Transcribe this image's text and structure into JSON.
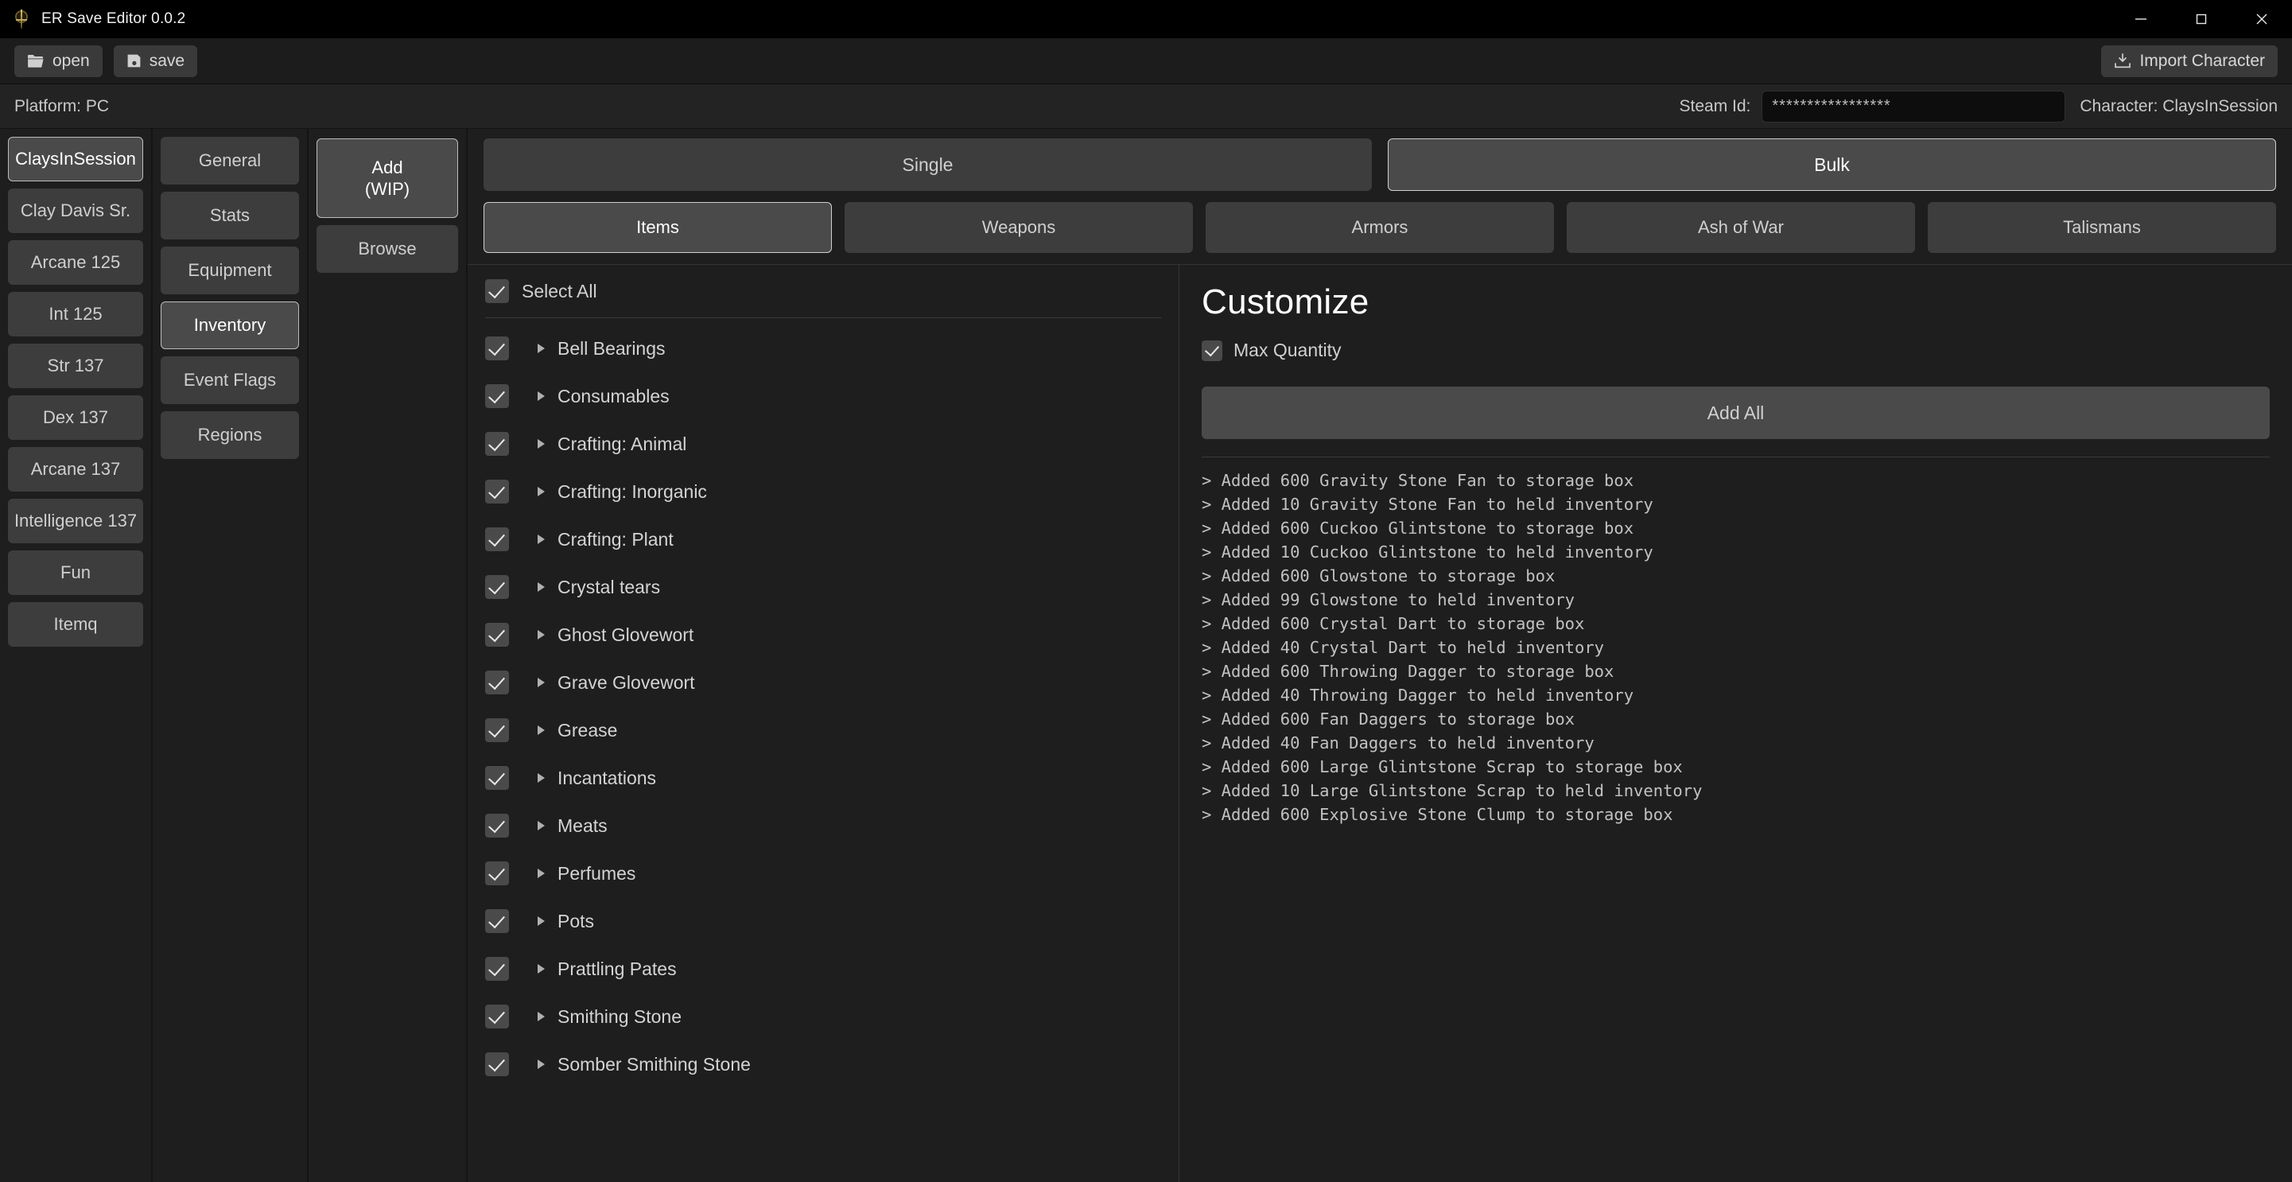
{
  "window": {
    "title": "ER Save Editor 0.0.2",
    "app_icon": "elden-ring-emblem-icon",
    "minimize_icon": "minimize-icon",
    "maximize_icon": "maximize-icon",
    "close_icon": "close-icon"
  },
  "toolbar": {
    "open_label": "open",
    "open_icon": "folder-open-icon",
    "save_label": "save",
    "save_icon": "floppy-disk-icon",
    "import_label": "Import Character",
    "import_icon": "download-icon"
  },
  "infobar": {
    "platform": "Platform: PC",
    "steam_id_label": "Steam Id:",
    "steam_id_value": "*****************",
    "character_label": "Character: ClaysInSession"
  },
  "characters": {
    "selected": "ClaysInSession",
    "items": [
      {
        "label": "ClaysInSession"
      },
      {
        "label": "Clay Davis Sr."
      },
      {
        "label": "Arcane 125"
      },
      {
        "label": "Int 125"
      },
      {
        "label": "Str 137"
      },
      {
        "label": "Dex 137"
      },
      {
        "label": "Arcane 137"
      },
      {
        "label": "Intelligence 137"
      },
      {
        "label": "Fun"
      },
      {
        "label": "Itemq"
      }
    ]
  },
  "sections": {
    "selected": "Inventory",
    "items": [
      {
        "label": "General"
      },
      {
        "label": "Stats"
      },
      {
        "label": "Equipment"
      },
      {
        "label": "Inventory"
      },
      {
        "label": "Event Flags"
      },
      {
        "label": "Regions"
      }
    ]
  },
  "mode_column": {
    "selected": "Add\n(WIP)",
    "items": [
      {
        "line1": "Add",
        "line2": "(WIP)"
      },
      {
        "line1": "Browse",
        "line2": ""
      }
    ]
  },
  "mode_tabs": {
    "selected": "Bulk",
    "items": [
      {
        "label": "Single"
      },
      {
        "label": "Bulk"
      }
    ]
  },
  "category_tabs": {
    "selected": "Items",
    "items": [
      {
        "label": "Items"
      },
      {
        "label": "Weapons"
      },
      {
        "label": "Armors"
      },
      {
        "label": "Ash of War"
      },
      {
        "label": "Talismans"
      }
    ]
  },
  "item_list": {
    "select_all_label": "Select All",
    "select_all_checked": true,
    "rows": [
      {
        "label": "Bell Bearings",
        "checked": true
      },
      {
        "label": "Consumables",
        "checked": true
      },
      {
        "label": "Crafting: Animal",
        "checked": true
      },
      {
        "label": "Crafting: Inorganic",
        "checked": true
      },
      {
        "label": "Crafting: Plant",
        "checked": true
      },
      {
        "label": "Crystal tears",
        "checked": true
      },
      {
        "label": "Ghost Glovewort",
        "checked": true
      },
      {
        "label": "Grave Glovewort",
        "checked": true
      },
      {
        "label": "Grease",
        "checked": true
      },
      {
        "label": "Incantations",
        "checked": true
      },
      {
        "label": "Meats",
        "checked": true
      },
      {
        "label": "Perfumes",
        "checked": true
      },
      {
        "label": "Pots",
        "checked": true
      },
      {
        "label": "Prattling Pates",
        "checked": true
      },
      {
        "label": "Smithing Stone",
        "checked": true
      },
      {
        "label": "Somber Smithing Stone",
        "checked": true
      }
    ]
  },
  "customize": {
    "title": "Customize",
    "max_quantity_label": "Max Quantity",
    "max_quantity_checked": true,
    "add_all_label": "Add All",
    "log_lines": [
      "> Added 600 Gravity Stone Fan to storage box",
      "> Added 10 Gravity Stone Fan to held inventory",
      "> Added 600 Cuckoo Glintstone to storage box",
      "> Added 10 Cuckoo Glintstone to held inventory",
      "> Added 600 Glowstone to storage box",
      "> Added 99 Glowstone to held inventory",
      "> Added 600 Crystal Dart to storage box",
      "> Added 40 Crystal Dart to held inventory",
      "> Added 600 Throwing Dagger to storage box",
      "> Added 40 Throwing Dagger to held inventory",
      "> Added 600 Fan Daggers to storage box",
      "> Added 40 Fan Daggers to held inventory",
      "> Added 600 Large Glintstone Scrap to storage box",
      "> Added 10 Large Glintstone Scrap to held inventory",
      "> Added 600 Explosive Stone Clump to storage box"
    ]
  },
  "colors": {
    "background": "#1e1e1e",
    "titlebar": "#000000",
    "button": "#3d3d3d",
    "button_selected_border": "#bdbdbd",
    "text": "#cfcfcf",
    "text_bright": "#ffffff"
  }
}
